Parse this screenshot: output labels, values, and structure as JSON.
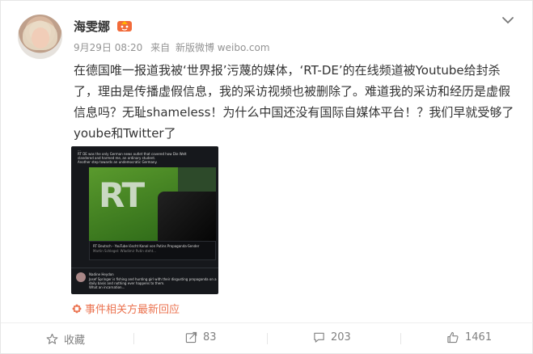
{
  "post": {
    "username": "海雯娜",
    "meta": {
      "date": "9月29日 08:20",
      "via_prefix": "来自",
      "source": "新版微博 weibo.com"
    },
    "text": "在德国唯一报道我被‘世界报’污蔑的媒体，‘RT-DE’的在线频道被Youtube给封杀了，理由是传播虚假信息，我的采访视频也被删除了。难道我的采访和经历是虚假信息吗？无耻shameless！为什么中国还没有国际自媒体平台！？我们早就受够了yoube和Twitter了",
    "related_label": "事件相关方最新回应"
  },
  "embedded_screenshot": {
    "lines_top": [
      "...",
      "RT DE was the only German news outlet that covered how Die Welt",
      "slandered and harmed me, an ordinary student.",
      "Another step towards an undemocratic Germany."
    ],
    "caption": [
      "RT Deutsch - YouTube löscht Kanal von Putins Propaganda-Sender",
      "Martin Schlegel: Wladimir Putin steht..."
    ],
    "reply_user": "Nadine Heydon",
    "reply_lines": [
      "Josef Springer is fishing and hunting girl with their disgusting propaganda on a",
      "daily basis and nothing ever happens to them.",
      "What an incarnation..."
    ]
  },
  "actions": {
    "favorite": "收藏",
    "repost": "83",
    "comment": "203",
    "like": "1461"
  },
  "colors": {
    "accent": "#eb7350",
    "muted": "#939393"
  }
}
